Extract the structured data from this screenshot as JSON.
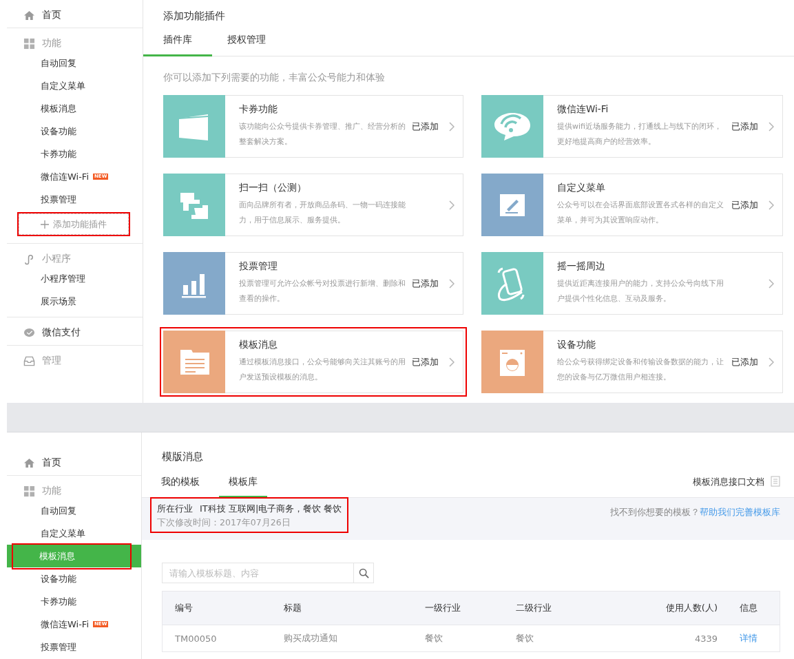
{
  "top_panel": {
    "sidebar": {
      "groups": [
        {
          "kind": "link",
          "label": "首页"
        },
        {
          "kind": "section",
          "label": "功能",
          "items": [
            {
              "label": "自动回复",
              "selected": false
            },
            {
              "label": "自定义菜单",
              "selected": false
            },
            {
              "label": "模板消息",
              "selected": false
            },
            {
              "label": "设备功能",
              "selected": false
            },
            {
              "label": "卡券功能",
              "selected": false
            },
            {
              "label": "微信连Wi-Fi",
              "selected": false,
              "badge": "NEW"
            },
            {
              "label": "投票管理",
              "selected": false
            }
          ],
          "add_button": {
            "label": "添加功能插件",
            "highlighted": true
          }
        },
        {
          "kind": "section",
          "label": "小程序",
          "items": [
            {
              "label": "小程序管理",
              "selected": false
            },
            {
              "label": "展示场景",
              "selected": false
            }
          ]
        },
        {
          "kind": "link",
          "label": "微信支付"
        },
        {
          "kind": "section",
          "label": "管理"
        }
      ]
    },
    "page_title": "添加功能插件",
    "tabs": [
      {
        "label": "插件库",
        "selected": true
      },
      {
        "label": "授权管理",
        "selected": false
      }
    ],
    "intro": "你可以添加下列需要的功能，丰富公众号能力和体验",
    "plugins": [
      {
        "kind": "card",
        "color": "#79cac1",
        "title": "卡券功能",
        "description": "该功能向公众号提供卡券管理、推广、经营分析的整套解决方案。",
        "status": "已添加",
        "highlighted": false
      },
      {
        "kind": "wifi",
        "color": "#79cac1",
        "title": "微信连Wi-Fi",
        "description": "提供wifi近场服务能力，打通线上与线下的闭环，更好地提高商户的经营效率。",
        "status": "已添加",
        "highlighted": false
      },
      {
        "kind": "scan",
        "color": "#79cac1",
        "title": "扫一扫（公测）",
        "description": "面向品牌所有者，开放商品条码、一物一码连接能力，用于信息展示、服务提供。",
        "highlighted": false
      },
      {
        "kind": "menu",
        "color": "#84a9ca",
        "title": "自定义菜单",
        "description": "公众号可以在会话界面底部设置各式各样的自定义菜单，并可为其设置响应动作。",
        "status": "已添加",
        "highlighted": false
      },
      {
        "kind": "vote",
        "color": "#84a9ca",
        "title": "投票管理",
        "description": "投票管理可允许公众帐号对投票进行新增、删除和查看的操作。",
        "status": "已添加",
        "highlighted": false
      },
      {
        "kind": "shake",
        "color": "#79cac1",
        "title": "摇一摇周边",
        "description": "提供近距离连接用户的能力，支持公众号向线下用户提供个性化信息、互动及服务。",
        "highlighted": false
      },
      {
        "kind": "template",
        "color": "#eba87e",
        "title": "模板消息",
        "description": "通过模板消息接口，公众号能够向关注其账号的用户发送预设模板的消息。",
        "status": "已添加",
        "highlighted": true
      },
      {
        "kind": "device",
        "color": "#eba87e",
        "title": "设备功能",
        "description": "给公众号获得绑定设备和传输设备数据的能力，让您的设备与亿万微信用户相连接。",
        "status": "已添加",
        "highlighted": false
      }
    ]
  },
  "bottom_panel": {
    "sidebar": {
      "groups": [
        {
          "kind": "link",
          "label": "首页"
        },
        {
          "kind": "section",
          "label": "功能",
          "items": [
            {
              "label": "自动回复",
              "selected": false
            },
            {
              "label": "自定义菜单",
              "selected": false
            },
            {
              "label": "模板消息",
              "selected": true,
              "highlighted": true
            },
            {
              "label": "设备功能",
              "selected": false
            },
            {
              "label": "卡券功能",
              "selected": false
            },
            {
              "label": "微信连Wi-Fi",
              "selected": false,
              "badge": "NEW"
            },
            {
              "label": "投票管理",
              "selected": false
            }
          ]
        }
      ]
    },
    "page_title": "模版消息",
    "tabs": [
      {
        "label": "我的模板",
        "selected": false
      },
      {
        "label": "模板库",
        "selected": true
      }
    ],
    "doc_link": "模板消息接口文档",
    "industry": {
      "label": "所在行业",
      "value": "IT科技 互联网|电子商务，餐饮 餐饮",
      "next_change": "下次修改时间：2017年07月26日",
      "highlighted": true
    },
    "help_text": "找不到你想要的模板？",
    "help_link": "帮助我们完善模板库",
    "search": {
      "placeholder": "请输入模板标题、内容"
    },
    "table": {
      "columns": [
        "编号",
        "标题",
        "一级行业",
        "二级行业",
        "使用人数(人)",
        "信息"
      ],
      "rows": [
        [
          "TM00050",
          "购买成功通知",
          "餐饮",
          "餐饮",
          "4339",
          "详情"
        ]
      ]
    }
  }
}
